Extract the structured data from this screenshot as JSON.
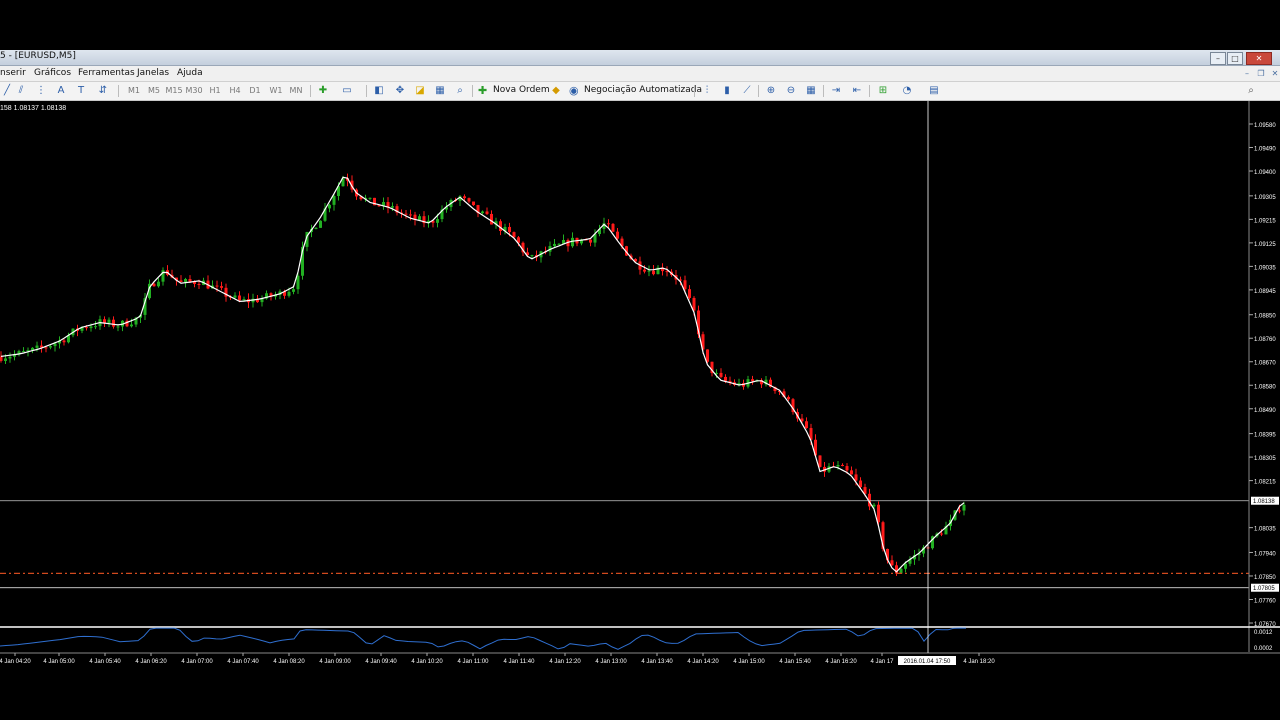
{
  "window": {
    "title": "5 - [EURUSD,M5]"
  },
  "menu": {
    "items": [
      "nserir",
      "Gráficos",
      "Ferramentas",
      "Janelas",
      "Ajuda"
    ]
  },
  "toolbar": {
    "timeframes": [
      "M1",
      "M5",
      "M15",
      "M30",
      "H1",
      "H4",
      "D1",
      "W1",
      "MN"
    ],
    "new_order_label": "Nova Ordem",
    "auto_trading_label": "Negociação Automatizada"
  },
  "chart": {
    "info_text": "158 1.08137 1.08138",
    "current_price_label": "1.08138",
    "low_price_label": "1.07805",
    "cursor_time_label": "2016.01.04 17:50",
    "colors": {
      "bull": "#22b022",
      "bear": "#ff1a1a",
      "ma": "#ffffff",
      "indicator": "#2f6fd0",
      "ask_line": "#d24a1e",
      "grid": "#888888"
    }
  },
  "chart_data": {
    "type": "candlestick",
    "symbol": "EURUSD",
    "timeframe": "M5",
    "y_ticks": [
      "1.09580",
      "1.09490",
      "1.09400",
      "1.09305",
      "1.09215",
      "1.09125",
      "1.09035",
      "1.08945",
      "1.08850",
      "1.08760",
      "1.08670",
      "1.08580",
      "1.08490",
      "1.08395",
      "1.08305",
      "1.08215",
      "1.08035",
      "1.07940",
      "1.07850",
      "1.07760",
      "1.07670"
    ],
    "ylim": [
      1.0767,
      1.0958
    ],
    "x_ticks": [
      "4 Jan 04:20",
      "4 Jan 05:00",
      "4 Jan 05:40",
      "4 Jan 06:20",
      "4 Jan 07:00",
      "4 Jan 07:40",
      "4 Jan 08:20",
      "4 Jan 09:00",
      "4 Jan 09:40",
      "4 Jan 10:20",
      "4 Jan 11:00",
      "4 Jan 11:40",
      "4 Jan 12:20",
      "4 Jan 13:00",
      "4 Jan 13:40",
      "4 Jan 14:20",
      "4 Jan 15:00",
      "4 Jan 15:40",
      "4 Jan 16:20",
      "4 Jan 17",
      "4 Jan 18:20"
    ],
    "close_path": [
      [
        0,
        1.0869
      ],
      [
        20,
        1.087
      ],
      [
        40,
        1.0872
      ],
      [
        60,
        1.0875
      ],
      [
        80,
        1.088
      ],
      [
        100,
        1.0882
      ],
      [
        120,
        1.0881
      ],
      [
        140,
        1.0884
      ],
      [
        150,
        1.0896
      ],
      [
        165,
        1.0902
      ],
      [
        180,
        1.0897
      ],
      [
        200,
        1.0898
      ],
      [
        220,
        1.0894
      ],
      [
        240,
        1.089
      ],
      [
        260,
        1.0891
      ],
      [
        280,
        1.0893
      ],
      [
        295,
        1.0896
      ],
      [
        305,
        1.0914
      ],
      [
        320,
        1.0922
      ],
      [
        335,
        1.0932
      ],
      [
        345,
        1.0939
      ],
      [
        355,
        1.0932
      ],
      [
        370,
        1.0928
      ],
      [
        390,
        1.0926
      ],
      [
        410,
        1.0922
      ],
      [
        430,
        1.092
      ],
      [
        445,
        1.0926
      ],
      [
        460,
        1.093
      ],
      [
        475,
        1.0925
      ],
      [
        495,
        1.092
      ],
      [
        515,
        1.0914
      ],
      [
        530,
        1.0906
      ],
      [
        550,
        1.091
      ],
      [
        570,
        1.0913
      ],
      [
        590,
        1.0914
      ],
      [
        605,
        1.092
      ],
      [
        620,
        1.0912
      ],
      [
        635,
        1.0905
      ],
      [
        650,
        1.0902
      ],
      [
        665,
        1.0903
      ],
      [
        680,
        1.0898
      ],
      [
        695,
        1.0885
      ],
      [
        705,
        1.0867
      ],
      [
        720,
        1.086
      ],
      [
        740,
        1.0858
      ],
      [
        760,
        1.086
      ],
      [
        780,
        1.0856
      ],
      [
        795,
        1.0848
      ],
      [
        810,
        1.0838
      ],
      [
        820,
        1.0825
      ],
      [
        835,
        1.0827
      ],
      [
        850,
        1.0824
      ],
      [
        865,
        1.0816
      ],
      [
        875,
        1.081
      ],
      [
        885,
        1.0793
      ],
      [
        895,
        1.0786
      ],
      [
        905,
        1.079
      ],
      [
        920,
        1.0794
      ],
      [
        935,
        1.08
      ],
      [
        950,
        1.0805
      ],
      [
        960,
        1.0812
      ],
      [
        968,
        1.0814
      ]
    ],
    "horizontal_lines": [
      1.08138,
      1.0786,
      1.07805
    ],
    "indicator_ticks": [
      "0.0012",
      "0.0002"
    ]
  }
}
